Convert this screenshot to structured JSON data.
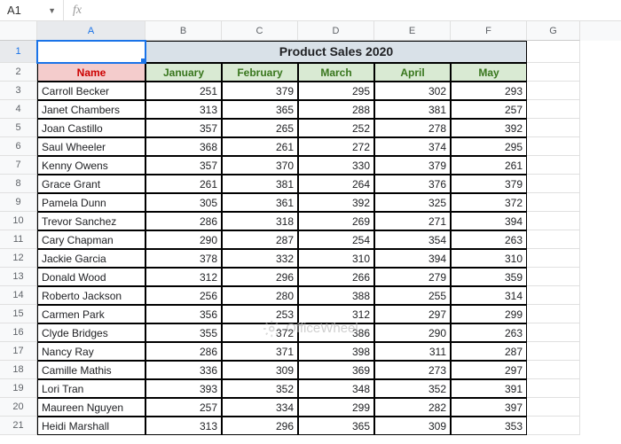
{
  "nameBox": "A1",
  "formula": "",
  "columns": [
    "A",
    "B",
    "C",
    "D",
    "E",
    "F",
    "G"
  ],
  "activeCol": "A",
  "activeRow": 1,
  "title": "Product Sales 2020",
  "headerName": "Name",
  "months": [
    "January",
    "February",
    "March",
    "April",
    "May"
  ],
  "rows": [
    {
      "name": "Carroll Becker",
      "vals": [
        251,
        379,
        295,
        302,
        293
      ]
    },
    {
      "name": "Janet Chambers",
      "vals": [
        313,
        365,
        288,
        381,
        257
      ]
    },
    {
      "name": "Joan Castillo",
      "vals": [
        357,
        265,
        252,
        278,
        392
      ]
    },
    {
      "name": "Saul Wheeler",
      "vals": [
        368,
        261,
        272,
        374,
        295
      ]
    },
    {
      "name": "Kenny Owens",
      "vals": [
        357,
        370,
        330,
        379,
        261
      ]
    },
    {
      "name": "Grace Grant",
      "vals": [
        261,
        381,
        264,
        376,
        379
      ]
    },
    {
      "name": "Pamela Dunn",
      "vals": [
        305,
        361,
        392,
        325,
        372
      ]
    },
    {
      "name": "Trevor Sanchez",
      "vals": [
        286,
        318,
        269,
        271,
        394
      ]
    },
    {
      "name": "Cary Chapman",
      "vals": [
        290,
        287,
        254,
        354,
        263
      ]
    },
    {
      "name": "Jackie Garcia",
      "vals": [
        378,
        332,
        310,
        394,
        310
      ]
    },
    {
      "name": "Donald Wood",
      "vals": [
        312,
        296,
        266,
        279,
        359
      ]
    },
    {
      "name": "Roberto Jackson",
      "vals": [
        256,
        280,
        388,
        255,
        314
      ]
    },
    {
      "name": "Carmen Park",
      "vals": [
        356,
        253,
        312,
        297,
        299
      ]
    },
    {
      "name": "Clyde Bridges",
      "vals": [
        355,
        372,
        386,
        290,
        263
      ]
    },
    {
      "name": "Nancy Ray",
      "vals": [
        286,
        371,
        398,
        311,
        287
      ]
    },
    {
      "name": "Camille Mathis",
      "vals": [
        336,
        309,
        369,
        273,
        297
      ]
    },
    {
      "name": "Lori Tran",
      "vals": [
        393,
        352,
        348,
        352,
        391
      ]
    },
    {
      "name": "Maureen Nguyen",
      "vals": [
        257,
        334,
        299,
        282,
        397
      ]
    },
    {
      "name": "Heidi Marshall",
      "vals": [
        313,
        296,
        365,
        309,
        353
      ]
    }
  ],
  "watermark": "OfficeWheel",
  "chart_data": {
    "type": "table",
    "title": "Product Sales 2020",
    "categories": [
      "January",
      "February",
      "March",
      "April",
      "May"
    ],
    "series": [
      {
        "name": "Carroll Becker",
        "values": [
          251,
          379,
          295,
          302,
          293
        ]
      },
      {
        "name": "Janet Chambers",
        "values": [
          313,
          365,
          288,
          381,
          257
        ]
      },
      {
        "name": "Joan Castillo",
        "values": [
          357,
          265,
          252,
          278,
          392
        ]
      },
      {
        "name": "Saul Wheeler",
        "values": [
          368,
          261,
          272,
          374,
          295
        ]
      },
      {
        "name": "Kenny Owens",
        "values": [
          357,
          370,
          330,
          379,
          261
        ]
      },
      {
        "name": "Grace Grant",
        "values": [
          261,
          381,
          264,
          376,
          379
        ]
      },
      {
        "name": "Pamela Dunn",
        "values": [
          305,
          361,
          392,
          325,
          372
        ]
      },
      {
        "name": "Trevor Sanchez",
        "values": [
          286,
          318,
          269,
          271,
          394
        ]
      },
      {
        "name": "Cary Chapman",
        "values": [
          290,
          287,
          254,
          354,
          263
        ]
      },
      {
        "name": "Jackie Garcia",
        "values": [
          378,
          332,
          310,
          394,
          310
        ]
      },
      {
        "name": "Donald Wood",
        "values": [
          312,
          296,
          266,
          279,
          359
        ]
      },
      {
        "name": "Roberto Jackson",
        "values": [
          256,
          280,
          388,
          255,
          314
        ]
      },
      {
        "name": "Carmen Park",
        "values": [
          356,
          253,
          312,
          297,
          299
        ]
      },
      {
        "name": "Clyde Bridges",
        "values": [
          355,
          372,
          386,
          290,
          263
        ]
      },
      {
        "name": "Nancy Ray",
        "values": [
          286,
          371,
          398,
          311,
          287
        ]
      },
      {
        "name": "Camille Mathis",
        "values": [
          336,
          309,
          369,
          273,
          297
        ]
      },
      {
        "name": "Lori Tran",
        "values": [
          393,
          352,
          348,
          352,
          391
        ]
      },
      {
        "name": "Maureen Nguyen",
        "values": [
          257,
          334,
          299,
          282,
          397
        ]
      },
      {
        "name": "Heidi Marshall",
        "values": [
          313,
          296,
          365,
          309,
          353
        ]
      }
    ]
  }
}
